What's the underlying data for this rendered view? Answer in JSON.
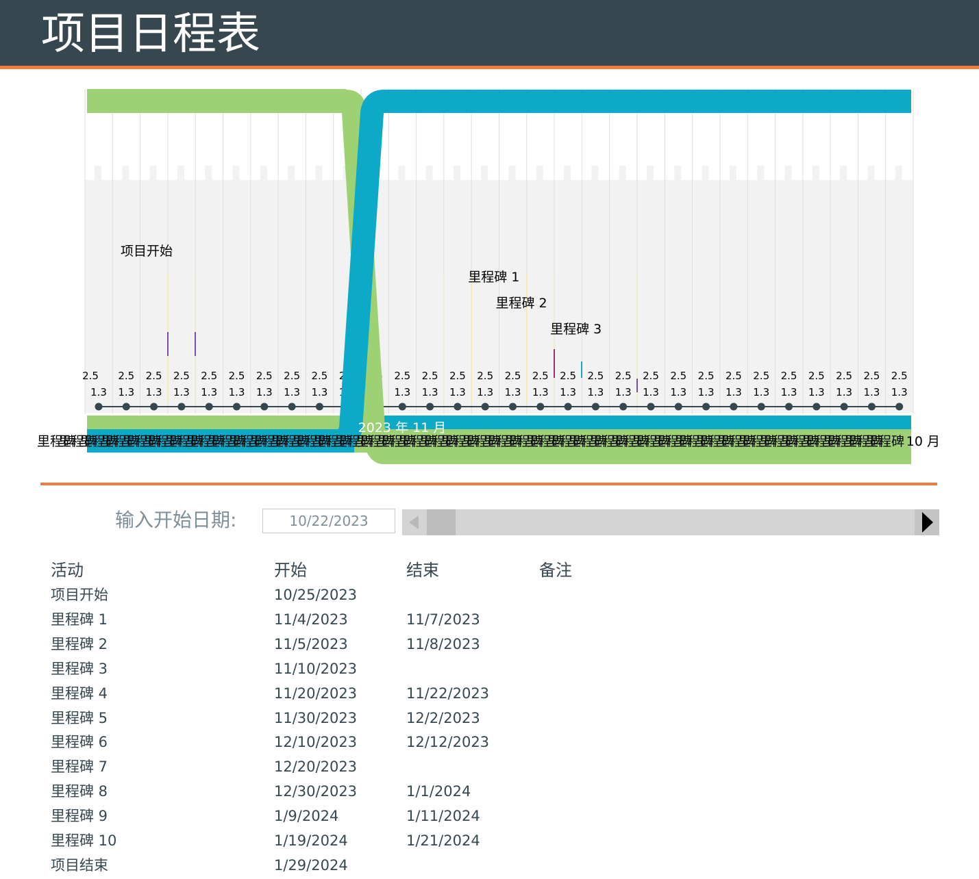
{
  "header": {
    "title": "项目日程表"
  },
  "colors": {
    "header_bg": "#37474f",
    "accent": "#f07c3b",
    "green": "#9dd174",
    "blue": "#0da9c8",
    "grey": "#f2f2f2"
  },
  "chart_data": {
    "type": "timeline",
    "month_label": "2023 年 11 月",
    "right_month_label": "10 月",
    "label_top": "2.5",
    "label_bottom": "1.3",
    "column_count": 30,
    "milestone_labels": [
      {
        "text": "项目开始",
        "column": 1.5
      },
      {
        "text": "里程碑  1",
        "column": 14
      },
      {
        "text": "里程碑  2",
        "column": 15
      },
      {
        "text": "里程碑  3",
        "column": 17
      }
    ],
    "bottom_text_noise": "里程碑里程碑里程碑"
  },
  "form": {
    "start_label": "输入开始日期:",
    "start_value": "10/22/2023"
  },
  "table": {
    "headers": {
      "activity": "活动",
      "start": "开始",
      "end": "结束",
      "notes": "备注"
    },
    "rows": [
      {
        "activity": "项目开始",
        "start": "10/25/2023",
        "end": ""
      },
      {
        "activity": "里程碑 1",
        "start": "11/4/2023",
        "end": "11/7/2023"
      },
      {
        "activity": "里程碑 2",
        "start": "11/5/2023",
        "end": "11/8/2023"
      },
      {
        "activity": "里程碑 3",
        "start": "11/10/2023",
        "end": ""
      },
      {
        "activity": "里程碑 4",
        "start": "11/20/2023",
        "end": "11/22/2023"
      },
      {
        "activity": "里程碑 5",
        "start": "11/30/2023",
        "end": "12/2/2023"
      },
      {
        "activity": "里程碑 6",
        "start": "12/10/2023",
        "end": "12/12/2023"
      },
      {
        "activity": "里程碑 7",
        "start": "12/20/2023",
        "end": ""
      },
      {
        "activity": "里程碑 8",
        "start": "12/30/2023",
        "end": "1/1/2024"
      },
      {
        "activity": "里程碑 9",
        "start": "1/9/2024",
        "end": "1/11/2024"
      },
      {
        "activity": "里程碑 10",
        "start": "1/19/2024",
        "end": "1/21/2024"
      },
      {
        "activity": "项目结束",
        "start": "1/29/2024",
        "end": ""
      }
    ]
  }
}
